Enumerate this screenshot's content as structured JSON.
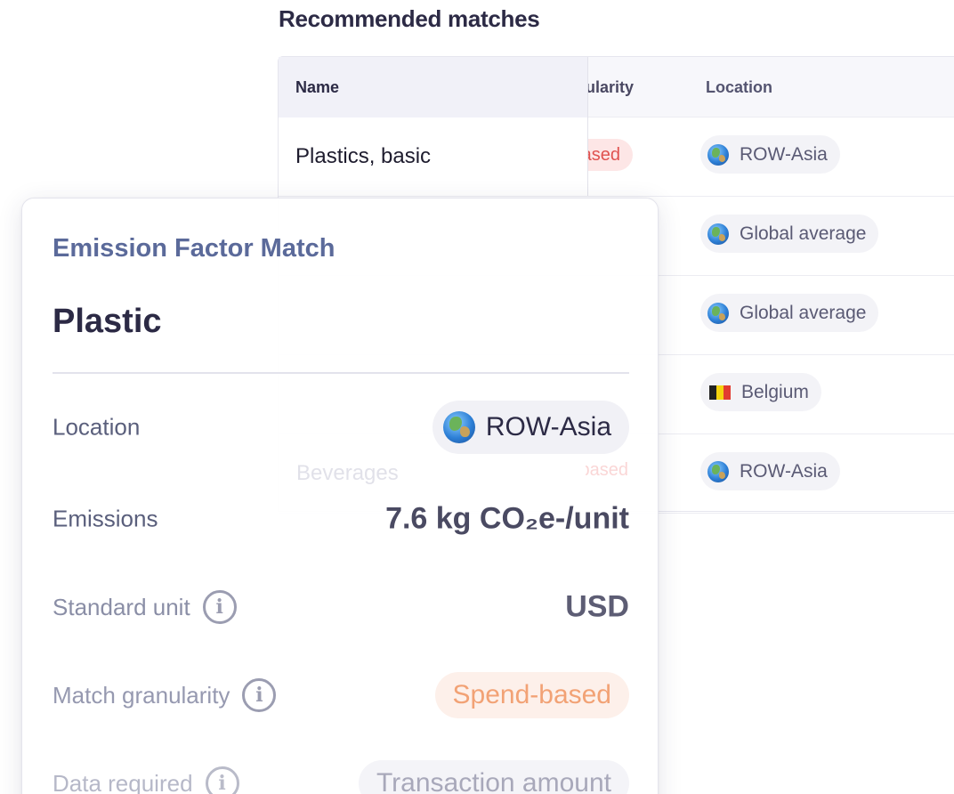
{
  "recommended": {
    "title": "Recommended matches",
    "headers": {
      "name": "Name",
      "granularity": "Match granularity",
      "location": "Location"
    },
    "rows": [
      {
        "name": "Plastics, basic",
        "granularity": "Spend-based",
        "location": "ROW-Asia",
        "location_icon": "globe-icon"
      },
      {
        "name": "",
        "granularity": "",
        "location": "Global average",
        "location_icon": "globe-icon"
      },
      {
        "name": "",
        "granularity": "",
        "location": "Global average",
        "location_icon": "globe-icon"
      },
      {
        "name": "",
        "granularity": "",
        "location": "Belgium",
        "location_icon": "belgium-flag-icon"
      },
      {
        "name": "Beverages",
        "granularity": "Spend-based",
        "location": "ROW-Asia",
        "location_icon": "globe-icon"
      }
    ]
  },
  "card": {
    "eyebrow": "Emission Factor Match",
    "title": "Plastic",
    "location_label": "Location",
    "location_value": "ROW-Asia",
    "emissions_label": "Emissions",
    "emissions_value": "7.6 kg CO₂e-/unit",
    "standard_unit_label": "Standard unit",
    "standard_unit_value": "USD",
    "granularity_label": "Match granularity",
    "granularity_value": "Spend-based",
    "data_required_label": "Data required",
    "data_required_value": "Transaction amount"
  },
  "colors": {
    "accent": "#5b6a9a",
    "spend_chip_text": "#f2a275",
    "spend_chip_bg": "#fdf0ea",
    "red_chip_text": "#e0524f"
  }
}
